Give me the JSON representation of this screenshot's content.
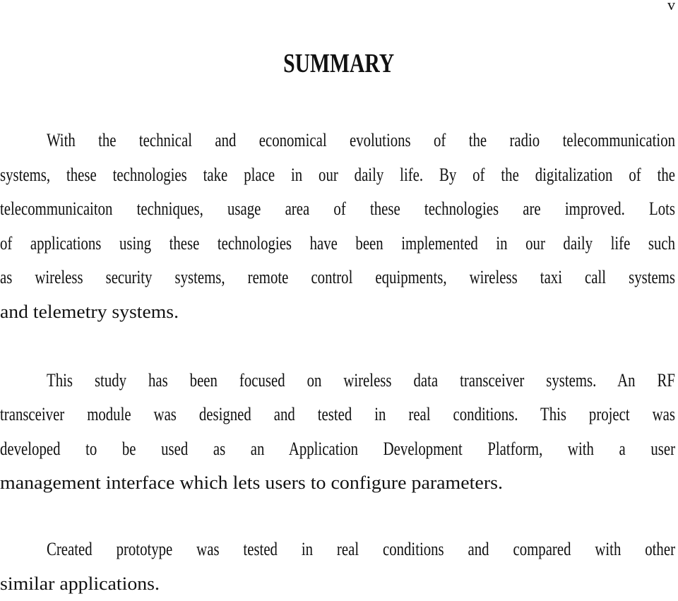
{
  "page_number": "v",
  "title": "SUMMARY",
  "paragraphs": [
    {
      "lines": [
        "With the technical and economical evolutions of the radio telecommunication",
        "systems, these technologies take place in our daily life. By of the digitalization of the",
        "telecommunicaiton techniques, usage area of these technologies are improved. Lots",
        "of applications using these technologies have been implemented in our daily life such",
        "as wireless security systems, remote control equipments, wireless taxi call systems",
        "and telemetry systems."
      ]
    },
    {
      "lines": [
        "This study has been focused  on wireless data transceiver systems. An RF",
        "transceiver module was designed and tested in real conditions. This project was",
        "developed to be used as an Application Development Platform, with a user",
        "management interface which lets users to configure parameters."
      ]
    },
    {
      "lines": [
        "Created prototype was tested in real conditions and compared with other",
        "similar applications."
      ]
    }
  ]
}
